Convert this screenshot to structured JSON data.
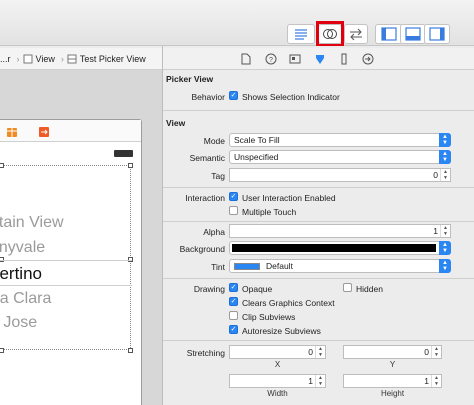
{
  "breadcrumb": {
    "item0": "...r",
    "item1": "View",
    "item2": "Test Picker View"
  },
  "picker_items": [
    "ntain View",
    "nnyvale",
    "pertino",
    "rta Clara",
    "n Jose"
  ],
  "inspector": {
    "picker_view": {
      "title": "Picker View",
      "behavior_label": "Behavior",
      "shows_selection_label": "Shows Selection Indicator",
      "shows_selection": true
    },
    "view": {
      "title": "View",
      "mode_label": "Mode",
      "mode_value": "Scale To Fill",
      "semantic_label": "Semantic",
      "semantic_value": "Unspecified",
      "tag_label": "Tag",
      "tag_value": "0",
      "interaction_label": "Interaction",
      "user_interaction_label": "User Interaction Enabled",
      "user_interaction": true,
      "multiple_touch_label": "Multiple Touch",
      "multiple_touch": false,
      "alpha_label": "Alpha",
      "alpha_value": "1",
      "background_label": "Background",
      "background_color": "#000000",
      "tint_label": "Tint",
      "tint_value": "Default",
      "tint_color": "#2a86f2",
      "drawing_label": "Drawing",
      "opaque_label": "Opaque",
      "opaque": true,
      "hidden_label": "Hidden",
      "hidden": false,
      "clears_label": "Clears Graphics Context",
      "clears": true,
      "clip_label": "Clip Subviews",
      "clip": false,
      "autoresize_label": "Autoresize Subviews",
      "autoresize": true,
      "stretching_label": "Stretching",
      "stretch_x": "0",
      "stretch_y": "0",
      "stretch_w": "1",
      "stretch_h": "1",
      "x_label": "X",
      "y_label": "Y",
      "width_label": "Width",
      "height_label": "Height"
    }
  },
  "colors": {
    "accent": "#2a86f2",
    "highlight": "#e00010"
  }
}
